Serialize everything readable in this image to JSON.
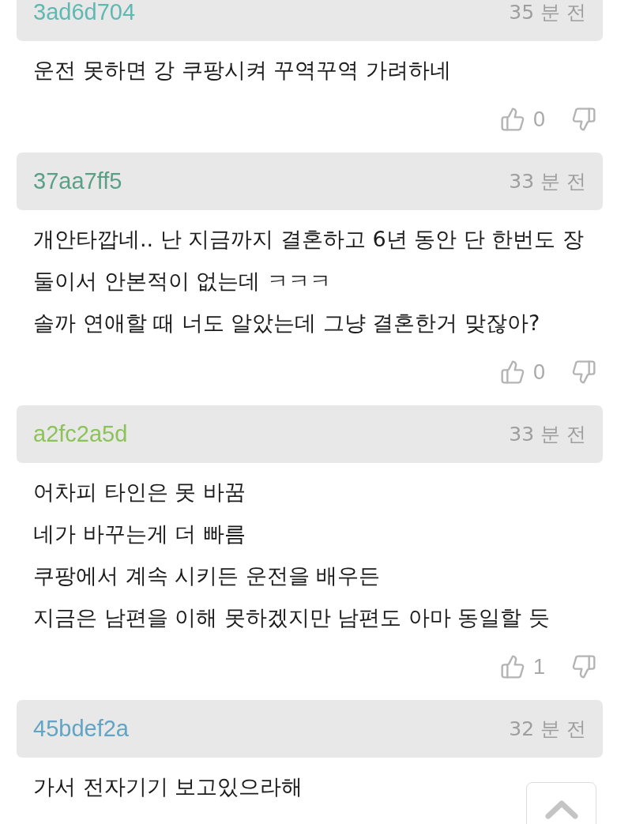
{
  "comments": [
    {
      "user": "3ad6d704",
      "color": "#5fb8b2",
      "time": "35 분 전",
      "lines": [
        "운전 못하면 강 쿠팡시켜 꾸역꾸역 가려하네"
      ],
      "likes": "0"
    },
    {
      "user": "37aa7ff5",
      "color": "#5a9f86",
      "time": "33 분 전",
      "lines": [
        "개안타깝네.. 난 지금까지 결혼하고 6년 동안 단 한번도 장",
        "둘이서 안본적이 없는데 ㅋㅋㅋ",
        "솔까 연애할 때 너도 알았는데 그냥 결혼한거 맞잖아?"
      ],
      "likes": "0"
    },
    {
      "user": "a2fc2a5d",
      "color": "#8cc25a",
      "time": "33 분 전",
      "lines": [
        "어차피 타인은 못 바꿈",
        "네가 바꾸는게 더 빠름",
        "쿠팡에서 계속 시키든 운전을 배우든",
        "지금은 남편을 이해 못하겠지만 남편도 아마 동일할 듯"
      ],
      "likes": "1"
    },
    {
      "user": "45bdef2a",
      "color": "#62a4c4",
      "time": "32 분 전",
      "lines": [
        "가서 전자기기 보고있으라해"
      ]
    }
  ]
}
